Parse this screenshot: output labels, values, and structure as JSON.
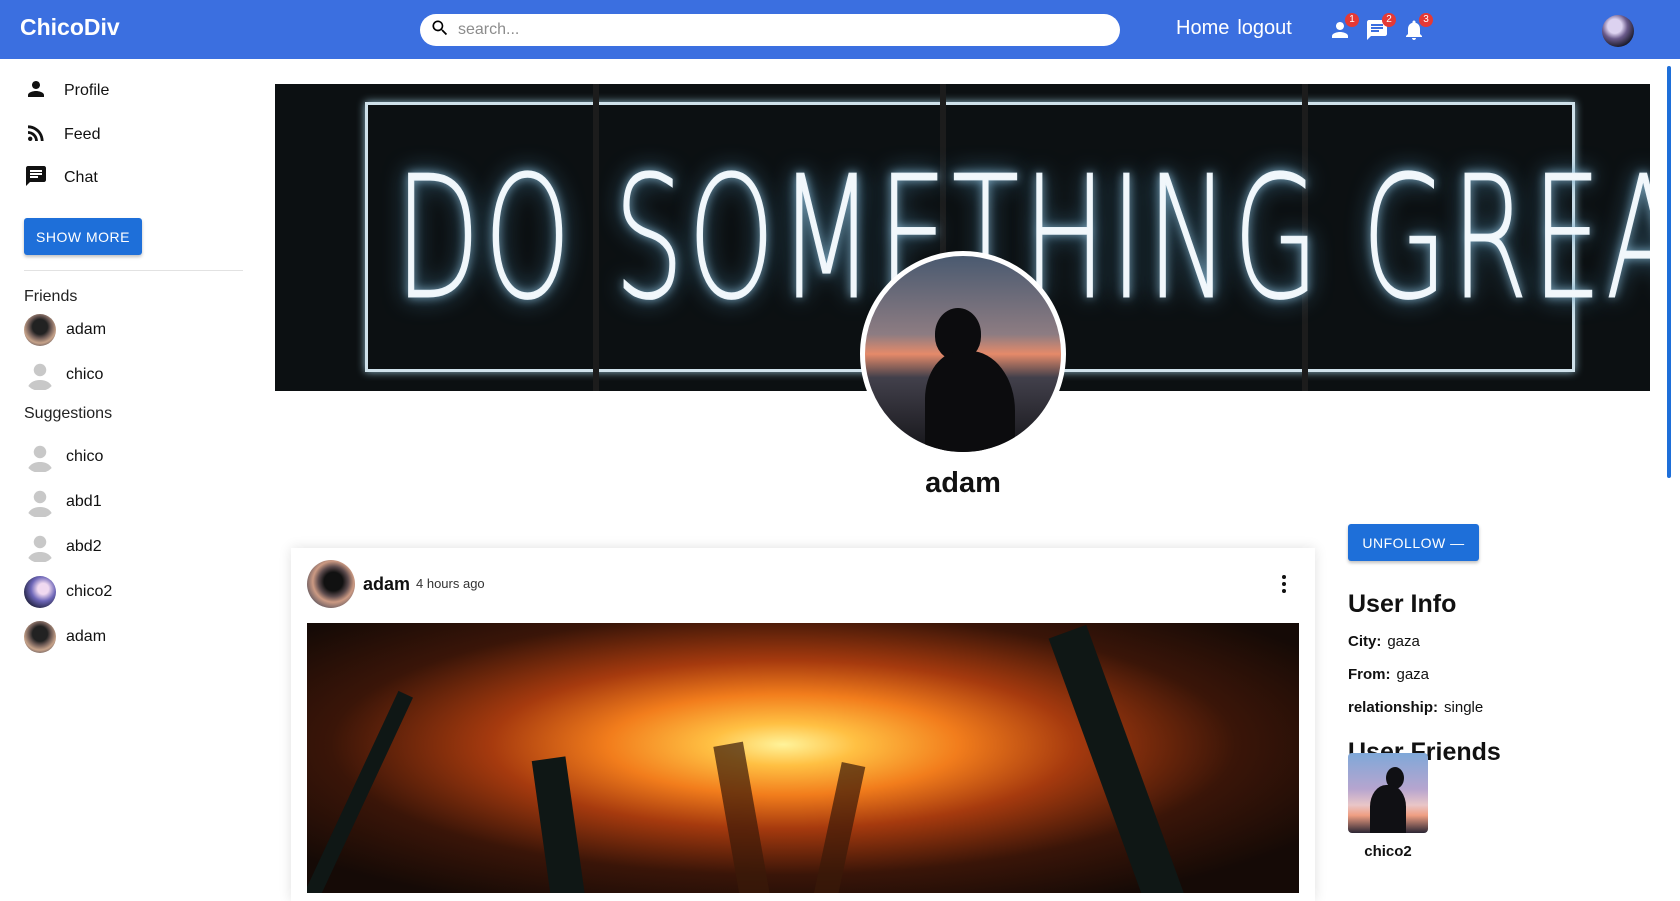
{
  "app": {
    "logo": "ChicoDiv",
    "accent_color": "#3b6fe0",
    "button_color": "#1e6fd9"
  },
  "search": {
    "placeholder": "search...",
    "icon": "search-icon"
  },
  "nav": {
    "home": "Home",
    "logout": "logout"
  },
  "notifications": [
    {
      "icon": "person-icon",
      "count": "1"
    },
    {
      "icon": "chat-icon",
      "count": "2"
    },
    {
      "icon": "bell-icon",
      "count": "3"
    }
  ],
  "sidebar": {
    "menu": [
      {
        "label": "Profile",
        "icon": "person-icon"
      },
      {
        "label": "Feed",
        "icon": "rss-icon"
      },
      {
        "label": "Chat",
        "icon": "chat-icon"
      }
    ],
    "show_more": "SHOW MORE",
    "friends_title": "Friends",
    "friends": [
      {
        "name": "adam"
      },
      {
        "name": "chico"
      }
    ],
    "suggestions_title": "Suggestions",
    "suggestions": [
      {
        "name": "chico"
      },
      {
        "name": "abd1"
      },
      {
        "name": "abd2"
      },
      {
        "name": "chico2"
      },
      {
        "name": "adam"
      }
    ]
  },
  "profile": {
    "cover_text": "DO SOMETHING GREAT",
    "name": "adam"
  },
  "post": {
    "user": "adam",
    "time": "4 hours ago"
  },
  "right_panel": {
    "unfollow": "UNFOLLOW —",
    "user_info_title": "User Info",
    "info": [
      {
        "label": "City:",
        "value": "gaza"
      },
      {
        "label": "From:",
        "value": "gaza"
      },
      {
        "label": "relationship:",
        "value": "single"
      }
    ],
    "friends_title": "User Friends",
    "friends": [
      {
        "name": "chico2"
      }
    ]
  }
}
